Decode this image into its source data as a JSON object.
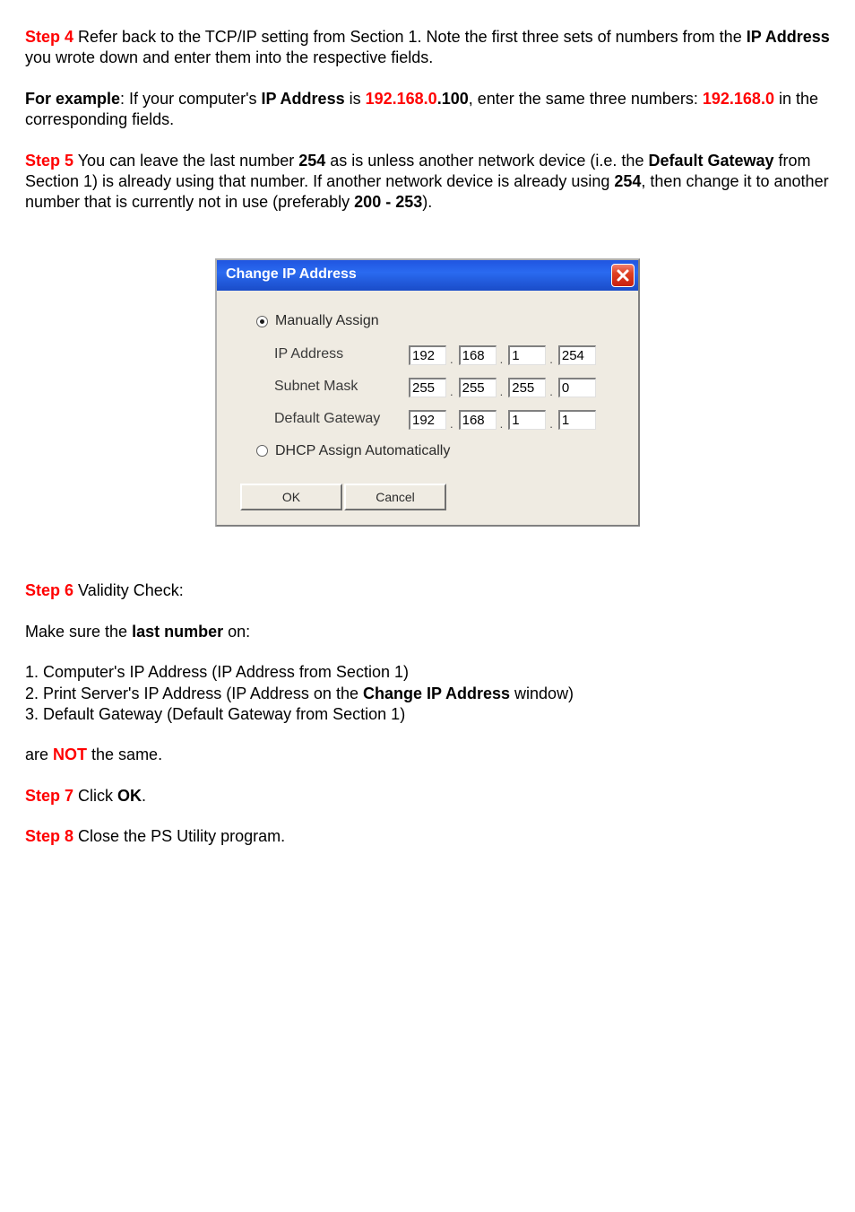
{
  "steps": {
    "s4": {
      "label": "Step 4",
      "text_a": " Refer back to the TCP/IP setting from Section 1. Note the first three sets of numbers from the  ",
      "ip_addr_bold": "IP Address",
      "text_b": " you wrote down and enter them into the respective fields."
    },
    "example": {
      "prefix": "For example",
      "text_a": ": If your computer's ",
      "ip_addr_bold": "IP Address",
      "text_b": " is ",
      "red_three": "192.168.0",
      "dot100": ".100",
      "text_c": ", enter the same three numbers: ",
      "red_three_2": "192.168.0",
      "text_d": " in the corresponding fields."
    },
    "s5": {
      "label": "Step 5",
      "text_a": " You can leave the last number ",
      "num254": "254",
      "text_b": " as is unless another network device (i.e. the ",
      "dg_bold": "Default Gateway",
      "text_c": " from Section 1) is already using that number. If another network device is already using ",
      "num254_2": "254",
      "text_d": ", then change it to another number that is currently not in use (preferably ",
      "range": "200 - 253",
      "text_e": ")."
    },
    "s6": {
      "label": "Step 6",
      "text": " Validity Check:"
    },
    "make_sure_a": "Make sure the ",
    "last_number": "last number",
    "make_sure_b": " on:",
    "list": {
      "i1": "1. Computer's IP Address (IP Address from Section 1)",
      "i2_a": "2. Print Server's IP Address (IP Address on the ",
      "i2_b": "Change IP Address",
      "i2_c": " window)",
      "i3": "3. Default Gateway (Default Gateway from Section 1)"
    },
    "are": "are ",
    "not": "NOT",
    "the_same": " the same.",
    "s7": {
      "label": "Step 7",
      "text_a": " Click ",
      "ok": "OK",
      "text_b": "."
    },
    "s8": {
      "label": "Step 8",
      "text": " Close the PS Utility program."
    }
  },
  "dialog": {
    "title": "Change IP Address",
    "close_title": "Close",
    "radio_manual": "Manually Assign",
    "radio_dhcp": "DHCP Assign Automatically",
    "labels": {
      "ip": "IP Address",
      "mask": "Subnet Mask",
      "gw": "Default Gateway"
    },
    "ip": {
      "o1": "192",
      "o2": "168",
      "o3": "1",
      "o4": "254"
    },
    "mask": {
      "o1": "255",
      "o2": "255",
      "o3": "255",
      "o4": "0"
    },
    "gw": {
      "o1": "192",
      "o2": "168",
      "o3": "1",
      "o4": "1"
    },
    "ok": "OK",
    "cancel": "Cancel"
  }
}
